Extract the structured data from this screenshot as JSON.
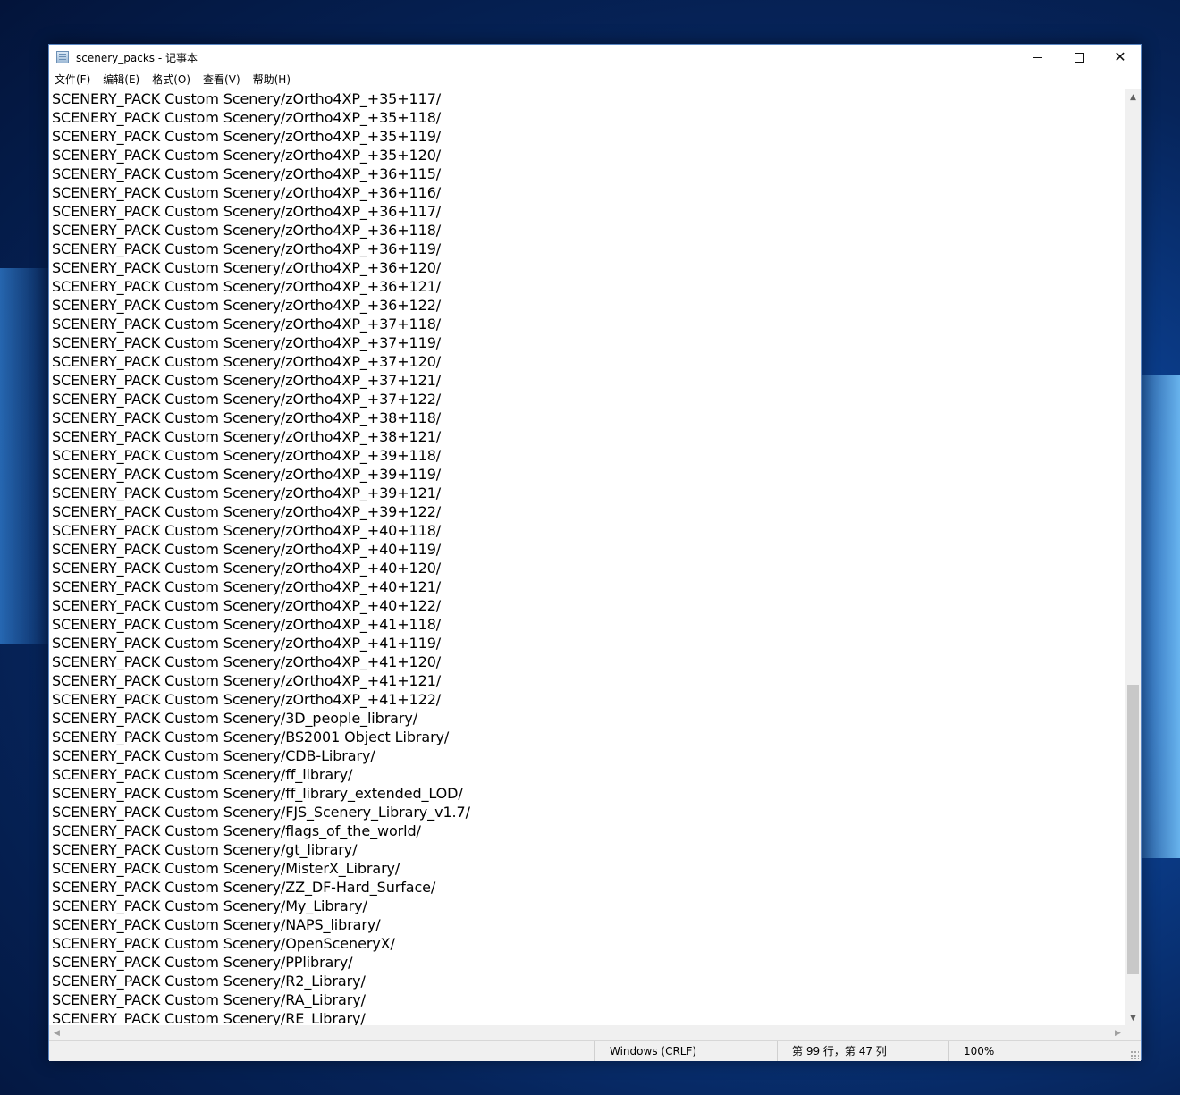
{
  "window": {
    "title": "scenery_packs - 记事本",
    "icon": "notepad-icon"
  },
  "menu": [
    {
      "label": "文件(F)"
    },
    {
      "label": "编辑(E)"
    },
    {
      "label": "格式(O)"
    },
    {
      "label": "查看(V)"
    },
    {
      "label": "帮助(H)"
    }
  ],
  "lines": [
    "SCENERY_PACK Custom Scenery/zOrtho4XP_+35+117/",
    "SCENERY_PACK Custom Scenery/zOrtho4XP_+35+118/",
    "SCENERY_PACK Custom Scenery/zOrtho4XP_+35+119/",
    "SCENERY_PACK Custom Scenery/zOrtho4XP_+35+120/",
    "SCENERY_PACK Custom Scenery/zOrtho4XP_+36+115/",
    "SCENERY_PACK Custom Scenery/zOrtho4XP_+36+116/",
    "SCENERY_PACK Custom Scenery/zOrtho4XP_+36+117/",
    "SCENERY_PACK Custom Scenery/zOrtho4XP_+36+118/",
    "SCENERY_PACK Custom Scenery/zOrtho4XP_+36+119/",
    "SCENERY_PACK Custom Scenery/zOrtho4XP_+36+120/",
    "SCENERY_PACK Custom Scenery/zOrtho4XP_+36+121/",
    "SCENERY_PACK Custom Scenery/zOrtho4XP_+36+122/",
    "SCENERY_PACK Custom Scenery/zOrtho4XP_+37+118/",
    "SCENERY_PACK Custom Scenery/zOrtho4XP_+37+119/",
    "SCENERY_PACK Custom Scenery/zOrtho4XP_+37+120/",
    "SCENERY_PACK Custom Scenery/zOrtho4XP_+37+121/",
    "SCENERY_PACK Custom Scenery/zOrtho4XP_+37+122/",
    "SCENERY_PACK Custom Scenery/zOrtho4XP_+38+118/",
    "SCENERY_PACK Custom Scenery/zOrtho4XP_+38+121/",
    "SCENERY_PACK Custom Scenery/zOrtho4XP_+39+118/",
    "SCENERY_PACK Custom Scenery/zOrtho4XP_+39+119/",
    "SCENERY_PACK Custom Scenery/zOrtho4XP_+39+121/",
    "SCENERY_PACK Custom Scenery/zOrtho4XP_+39+122/",
    "SCENERY_PACK Custom Scenery/zOrtho4XP_+40+118/",
    "SCENERY_PACK Custom Scenery/zOrtho4XP_+40+119/",
    "SCENERY_PACK Custom Scenery/zOrtho4XP_+40+120/",
    "SCENERY_PACK Custom Scenery/zOrtho4XP_+40+121/",
    "SCENERY_PACK Custom Scenery/zOrtho4XP_+40+122/",
    "SCENERY_PACK Custom Scenery/zOrtho4XP_+41+118/",
    "SCENERY_PACK Custom Scenery/zOrtho4XP_+41+119/",
    "SCENERY_PACK Custom Scenery/zOrtho4XP_+41+120/",
    "SCENERY_PACK Custom Scenery/zOrtho4XP_+41+121/",
    "SCENERY_PACK Custom Scenery/zOrtho4XP_+41+122/",
    "SCENERY_PACK Custom Scenery/3D_people_library/",
    "SCENERY_PACK Custom Scenery/BS2001 Object Library/",
    "SCENERY_PACK Custom Scenery/CDB-Library/",
    "SCENERY_PACK Custom Scenery/ff_library/",
    "SCENERY_PACK Custom Scenery/ff_library_extended_LOD/",
    "SCENERY_PACK Custom Scenery/FJS_Scenery_Library_v1.7/",
    "SCENERY_PACK Custom Scenery/flags_of_the_world/",
    "SCENERY_PACK Custom Scenery/gt_library/",
    "SCENERY_PACK Custom Scenery/MisterX_Library/",
    "SCENERY_PACK Custom Scenery/ZZ_DF-Hard_Surface/",
    "SCENERY_PACK Custom Scenery/My_Library/",
    "SCENERY_PACK Custom Scenery/NAPS_library/",
    "SCENERY_PACK Custom Scenery/OpenSceneryX/",
    "SCENERY_PACK Custom Scenery/PPlibrary/",
    "SCENERY_PACK Custom Scenery/R2_Library/",
    "SCENERY_PACK Custom Scenery/RA_Library/",
    "SCENERY_PACK Custom Scenery/RE_Library/"
  ],
  "status": {
    "encoding": "Windows (CRLF)",
    "position": "第 99 行，第 47 列",
    "zoom": "100%"
  }
}
